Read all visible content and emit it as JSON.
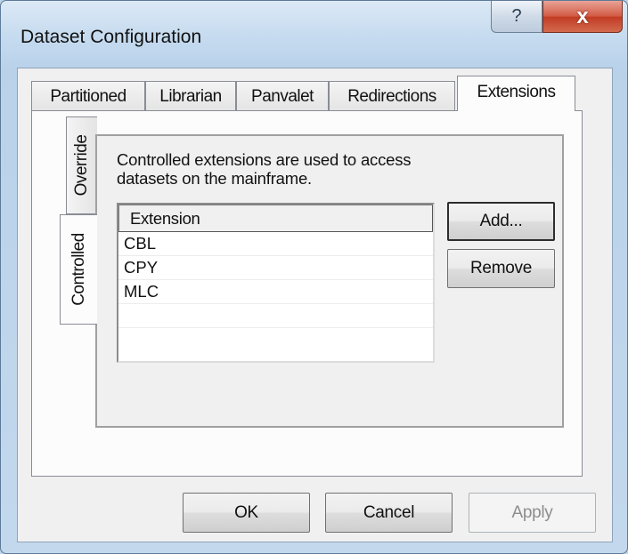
{
  "window": {
    "title": "Dataset Configuration",
    "help_icon": "?",
    "close_icon": "x"
  },
  "tabs": [
    {
      "label": "Partitioned",
      "active": false
    },
    {
      "label": "Librarian",
      "active": false
    },
    {
      "label": "Panvalet",
      "active": false
    },
    {
      "label": "Redirections",
      "active": false
    },
    {
      "label": "Extensions",
      "active": true
    }
  ],
  "side_tabs": [
    {
      "label": "Override",
      "active": false
    },
    {
      "label": "Controlled",
      "active": true
    }
  ],
  "controlled": {
    "description_line1": "Controlled extensions are used to access",
    "description_line2": "datasets on the  mainframe.",
    "list_header": "Extension",
    "extensions": [
      "CBL",
      "CPY",
      "MLC",
      "",
      ""
    ],
    "add_button": "Add...",
    "remove_button": "Remove"
  },
  "footer": {
    "ok": "OK",
    "cancel": "Cancel",
    "apply": "Apply"
  }
}
